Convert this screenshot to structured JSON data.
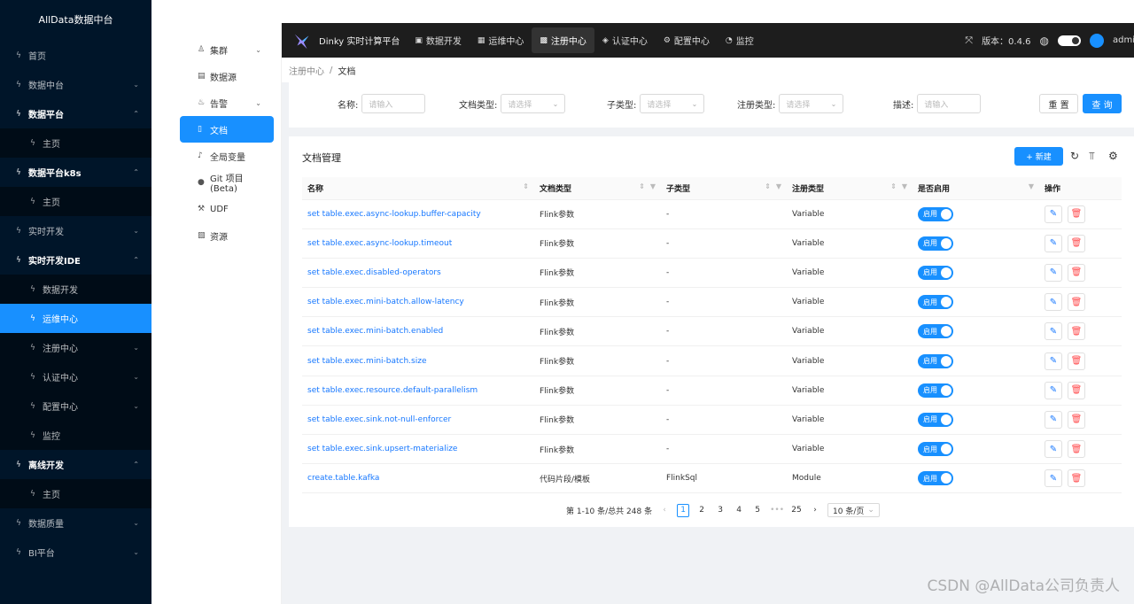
{
  "sidebar": {
    "brand": "AllData数据中台",
    "items": [
      {
        "label": "首页",
        "bold": false,
        "sub": false,
        "chev": ""
      },
      {
        "label": "数据中台",
        "bold": false,
        "sub": false,
        "chev": "⌄"
      },
      {
        "label": "数据平台",
        "bold": true,
        "sub": false,
        "chev": "⌃"
      },
      {
        "label": "主页",
        "bold": false,
        "sub": true,
        "chev": ""
      },
      {
        "label": "数据平台k8s",
        "bold": true,
        "sub": false,
        "chev": "⌃"
      },
      {
        "label": "主页",
        "bold": false,
        "sub": true,
        "chev": ""
      },
      {
        "label": "实时开发",
        "bold": false,
        "sub": false,
        "chev": "⌄"
      },
      {
        "label": "实时开发IDE",
        "bold": true,
        "sub": false,
        "chev": "⌃"
      },
      {
        "label": "数据开发",
        "bold": false,
        "sub": true,
        "chev": ""
      },
      {
        "label": "运维中心",
        "bold": false,
        "sub": true,
        "chev": "",
        "active": true
      },
      {
        "label": "注册中心",
        "bold": false,
        "sub": true,
        "chev": "⌄"
      },
      {
        "label": "认证中心",
        "bold": false,
        "sub": true,
        "chev": "⌄"
      },
      {
        "label": "配置中心",
        "bold": false,
        "sub": true,
        "chev": "⌄"
      },
      {
        "label": "监控",
        "bold": false,
        "sub": true,
        "chev": ""
      },
      {
        "label": "离线开发",
        "bold": true,
        "sub": false,
        "chev": "⌃"
      },
      {
        "label": "主页",
        "bold": false,
        "sub": true,
        "chev": ""
      },
      {
        "label": "数据质量",
        "bold": false,
        "sub": false,
        "chev": "⌄"
      },
      {
        "label": "BI平台",
        "bold": false,
        "sub": false,
        "chev": "⌄"
      }
    ]
  },
  "submenu": {
    "items": [
      {
        "label": "集群",
        "icon": "cluster-icon",
        "glyph": "♙",
        "chev": "⌄"
      },
      {
        "label": "数据源",
        "icon": "database-icon",
        "glyph": "▤",
        "chev": ""
      },
      {
        "label": "告警",
        "icon": "alarm-icon",
        "glyph": "♨",
        "chev": "⌄"
      },
      {
        "label": "文档",
        "icon": "document-icon",
        "glyph": "▯",
        "chev": "",
        "active": true
      },
      {
        "label": "全局变量",
        "icon": "variable-icon",
        "glyph": "♪",
        "chev": ""
      },
      {
        "label": "Git 项目(Beta)",
        "icon": "github-icon",
        "glyph": "●",
        "chev": ""
      },
      {
        "label": "UDF",
        "icon": "wrench-icon",
        "glyph": "⚒",
        "chev": ""
      },
      {
        "label": "资源",
        "icon": "resource-icon",
        "glyph": "▧",
        "chev": ""
      }
    ]
  },
  "header": {
    "app_title": "Dinky 实时计算平台",
    "nav": [
      {
        "label": "数据开发",
        "glyph": "▣"
      },
      {
        "label": "运维中心",
        "glyph": "▦"
      },
      {
        "label": "注册中心",
        "glyph": "▩",
        "active": true
      },
      {
        "label": "认证中心",
        "glyph": "◈"
      },
      {
        "label": "配置中心",
        "glyph": "⚙"
      },
      {
        "label": "监控",
        "glyph": "◔"
      }
    ],
    "version": "版本：0.4.6",
    "user": "admin"
  },
  "breadcrumb": {
    "parent": "注册中心",
    "current": "文档"
  },
  "filter": {
    "name_label": "名称:",
    "name_placeholder": "请输入",
    "doctype_label": "文档类型:",
    "doctype_placeholder": "请选择",
    "subtype_label": "子类型:",
    "subtype_placeholder": "请选择",
    "regtype_label": "注册类型:",
    "regtype_placeholder": "请选择",
    "desc_label": "描述:",
    "desc_placeholder": "请输入",
    "reset": "重 置",
    "query": "查 询"
  },
  "table": {
    "title": "文档管理",
    "new_button": "+ 新建",
    "columns": [
      "名称",
      "文档类型",
      "子类型",
      "注册类型",
      "是否启用",
      "操作"
    ],
    "switch_label": "启用",
    "rows": [
      {
        "name": "set table.exec.async-lookup.buffer-capacity",
        "doctype": "Flink参数",
        "subtype": "-",
        "regtype": "Variable"
      },
      {
        "name": "set table.exec.async-lookup.timeout",
        "doctype": "Flink参数",
        "subtype": "-",
        "regtype": "Variable"
      },
      {
        "name": "set table.exec.disabled-operators",
        "doctype": "Flink参数",
        "subtype": "-",
        "regtype": "Variable"
      },
      {
        "name": "set table.exec.mini-batch.allow-latency",
        "doctype": "Flink参数",
        "subtype": "-",
        "regtype": "Variable"
      },
      {
        "name": "set table.exec.mini-batch.enabled",
        "doctype": "Flink参数",
        "subtype": "-",
        "regtype": "Variable"
      },
      {
        "name": "set table.exec.mini-batch.size",
        "doctype": "Flink参数",
        "subtype": "-",
        "regtype": "Variable"
      },
      {
        "name": "set table.exec.resource.default-parallelism",
        "doctype": "Flink参数",
        "subtype": "-",
        "regtype": "Variable"
      },
      {
        "name": "set table.exec.sink.not-null-enforcer",
        "doctype": "Flink参数",
        "subtype": "-",
        "regtype": "Variable"
      },
      {
        "name": "set table.exec.sink.upsert-materialize",
        "doctype": "Flink参数",
        "subtype": "-",
        "regtype": "Variable"
      },
      {
        "name": "create.table.kafka",
        "doctype": "代码片段/模板",
        "subtype": "FlinkSql",
        "regtype": "Module"
      }
    ]
  },
  "pagination": {
    "summary": "第 1-10 条/总共 248 条",
    "pages": [
      "1",
      "2",
      "3",
      "4",
      "5",
      "•••",
      "25"
    ],
    "current": "1",
    "page_size": "10 条/页"
  },
  "watermark": "CSDN @AllData公司负责人",
  "colors": {
    "primary": "#1890ff",
    "sidebar_bg": "#001529",
    "header_bg": "#1d1d1d",
    "danger": "#ff4d4f"
  }
}
